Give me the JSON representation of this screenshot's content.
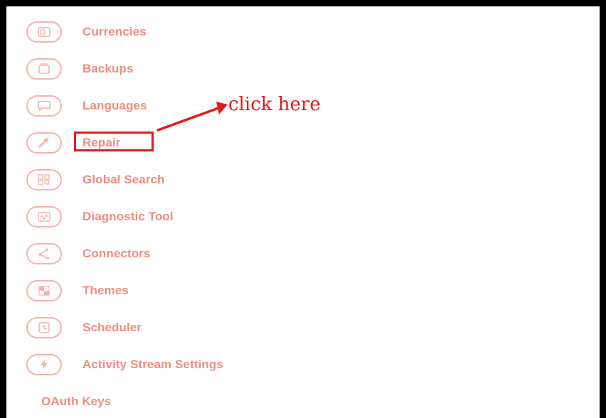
{
  "menu": {
    "items": [
      {
        "label": "Currencies",
        "icon": "currencies-icon"
      },
      {
        "label": "Backups",
        "icon": "backups-icon"
      },
      {
        "label": "Languages",
        "icon": "languages-icon"
      },
      {
        "label": "Repair",
        "icon": "wrench-icon"
      },
      {
        "label": "Global Search",
        "icon": "global-search-icon"
      },
      {
        "label": "Diagnostic Tool",
        "icon": "diagnostic-icon"
      },
      {
        "label": "Connectors",
        "icon": "connectors-icon"
      },
      {
        "label": "Themes",
        "icon": "themes-icon"
      },
      {
        "label": "Scheduler",
        "icon": "clock-icon"
      },
      {
        "label": "Activity Stream Settings",
        "icon": "bolt-icon"
      },
      {
        "label": "OAuth Keys",
        "icon": ""
      }
    ]
  },
  "annotation": {
    "text": "click here",
    "color": "#e31b1b"
  },
  "colors": {
    "label": "#ef8e7f",
    "icon_border": "#f4b4aa",
    "highlight": "#e31b1b",
    "frame": "#000000"
  }
}
